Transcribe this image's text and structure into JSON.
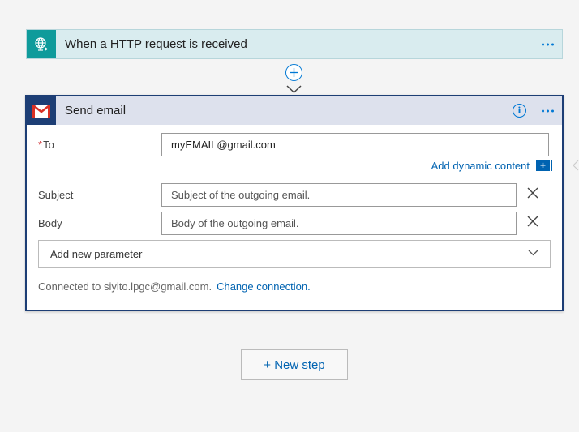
{
  "trigger": {
    "title": "When a HTTP request is received",
    "icon": "globe-request-icon",
    "color": "#0f9b9b"
  },
  "action": {
    "title": "Send email",
    "icon": "gmail-icon",
    "accent": "#1d3e75",
    "fields": {
      "to": {
        "required_mark": "*",
        "label": "To",
        "value": "myEMAIL@gmail.com"
      },
      "subject": {
        "label": "Subject",
        "placeholder": "Subject of the outgoing email."
      },
      "body": {
        "label": "Body",
        "placeholder": "Body of the outgoing email."
      }
    },
    "dynamic_content_label": "Add dynamic content",
    "dynamic_content_plus": "+",
    "add_parameter_label": "Add new parameter",
    "connection": {
      "text": "Connected to siyito.lpgc@gmail.com.",
      "change_label": "Change connection."
    }
  },
  "new_step_label": "+ New step"
}
